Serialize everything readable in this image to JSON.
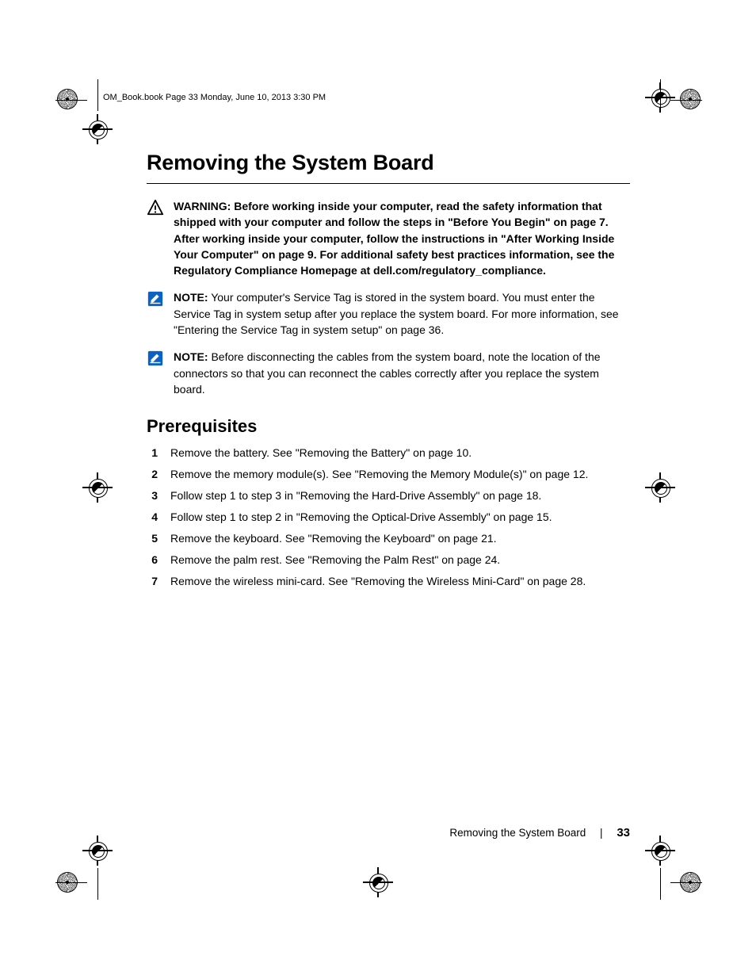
{
  "header_running": "OM_Book.book  Page 33  Monday, June 10, 2013  3:30 PM",
  "title": "Removing the System Board",
  "warning": {
    "label": "WARNING:",
    "text": "Before working inside your computer, read the safety information that shipped with your computer and follow the steps in \"Before You Begin\" on page 7. After working inside your computer, follow the instructions in \"After Working Inside Your Computer\" on page 9. For additional safety best practices information, see the Regulatory Compliance Homepage at dell.com/regulatory_compliance."
  },
  "notes": [
    {
      "label": "NOTE:",
      "text": "Your computer's Service Tag is stored in the system board. You must enter the Service Tag in system setup after you replace the system board. For more information, see \"Entering the Service Tag in system setup\" on page 36."
    },
    {
      "label": "NOTE:",
      "text": "Before disconnecting the cables from the system board, note the location of the connectors so that you can reconnect the cables correctly after you replace the system board."
    }
  ],
  "prereq_heading": "Prerequisites",
  "prereq": [
    {
      "n": "1",
      "t": "Remove the battery. See \"Removing the Battery\" on page 10."
    },
    {
      "n": "2",
      "t": "Remove the memory module(s). See \"Removing the Memory Module(s)\" on page 12."
    },
    {
      "n": "3",
      "t": "Follow step 1 to step 3 in \"Removing the Hard-Drive Assembly\" on page 18."
    },
    {
      "n": "4",
      "t": "Follow step 1 to step 2 in \"Removing the Optical-Drive Assembly\" on page 15."
    },
    {
      "n": "5",
      "t": "Remove the keyboard. See \"Removing the Keyboard\" on page 21."
    },
    {
      "n": "6",
      "t": "Remove the palm rest. See \"Removing the Palm Rest\" on page 24."
    },
    {
      "n": "7",
      "t": "Remove the wireless mini-card. See \"Removing the Wireless Mini-Card\" on page 28."
    }
  ],
  "footer": {
    "title": "Removing the System Board",
    "sep": "|",
    "page": "33"
  }
}
